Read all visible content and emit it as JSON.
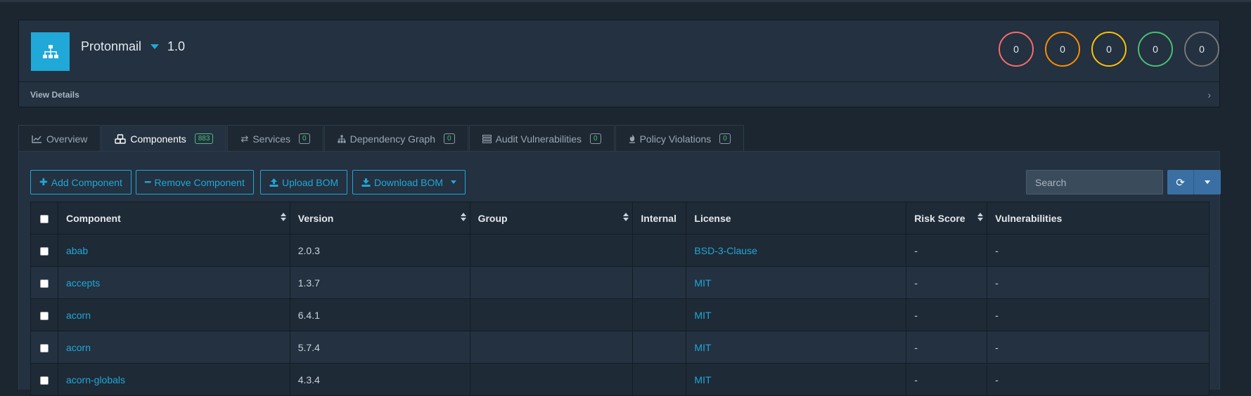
{
  "project": {
    "name": "Protonmail",
    "version": "1.0",
    "view_details": "View Details",
    "severity_counts": [
      {
        "severity": "critical",
        "count": "0",
        "color": "#f86c6b"
      },
      {
        "severity": "high",
        "count": "0",
        "color": "#fd8c00"
      },
      {
        "severity": "medium",
        "count": "0",
        "color": "#ffc107"
      },
      {
        "severity": "low",
        "count": "0",
        "color": "#4dbd74"
      },
      {
        "severity": "unassigned",
        "count": "0",
        "color": "#777777"
      }
    ]
  },
  "tabs": [
    {
      "label": "Overview",
      "icon": "line-chart-icon",
      "badge": null
    },
    {
      "label": "Components",
      "icon": "cubes-icon",
      "badge": "883"
    },
    {
      "label": "Services",
      "icon": "exchange-icon",
      "badge": "0"
    },
    {
      "label": "Dependency Graph",
      "icon": "sitemap-icon",
      "badge": "0"
    },
    {
      "label": "Audit Vulnerabilities",
      "icon": "tasks-icon",
      "badge": "0"
    },
    {
      "label": "Policy Violations",
      "icon": "fire-icon",
      "badge": "0"
    }
  ],
  "toolbar": {
    "add_component": "Add Component",
    "remove_component": "Remove Component",
    "upload_bom": "Upload BOM",
    "download_bom": "Download BOM",
    "search_placeholder": "Search"
  },
  "table": {
    "headers": {
      "component": "Component",
      "version": "Version",
      "group": "Group",
      "internal": "Internal",
      "license": "License",
      "risk_score": "Risk Score",
      "vulnerabilities": "Vulnerabilities"
    },
    "rows": [
      {
        "component": "abab",
        "version": "2.0.3",
        "group": "",
        "internal": "",
        "license": "BSD-3-Clause",
        "risk_score": "-",
        "vulnerabilities": "-"
      },
      {
        "component": "accepts",
        "version": "1.3.7",
        "group": "",
        "internal": "",
        "license": "MIT",
        "risk_score": "-",
        "vulnerabilities": "-"
      },
      {
        "component": "acorn",
        "version": "6.4.1",
        "group": "",
        "internal": "",
        "license": "MIT",
        "risk_score": "-",
        "vulnerabilities": "-"
      },
      {
        "component": "acorn",
        "version": "5.7.4",
        "group": "",
        "internal": "",
        "license": "MIT",
        "risk_score": "-",
        "vulnerabilities": "-"
      },
      {
        "component": "acorn-globals",
        "version": "4.3.4",
        "group": "",
        "internal": "",
        "license": "MIT",
        "risk_score": "-",
        "vulnerabilities": "-"
      }
    ]
  }
}
